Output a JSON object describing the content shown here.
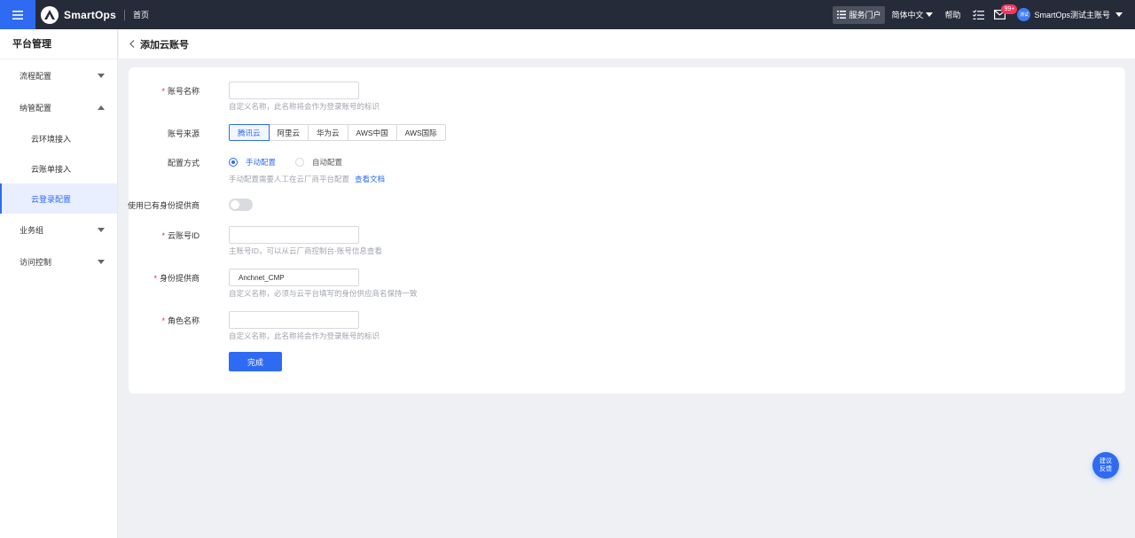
{
  "topbar": {
    "brand": "SmartOps",
    "home_link": "首页",
    "portal_label": "服务门户",
    "language": "简体中文",
    "help": "帮助",
    "mail_badge": "99+",
    "avatar_text": "测试",
    "user_name": "SmartOps测试主账号",
    "colors": {
      "bar": "#262b3a",
      "accent": "#2f6bf2",
      "badge": "#f5365c"
    }
  },
  "sidebar": {
    "title": "平台管理",
    "groups": [
      {
        "label": "流程配置",
        "icon": "chevron-down-icon"
      },
      {
        "label": "纳管配置",
        "icon": "chevron-up-icon",
        "expanded": true,
        "items": [
          {
            "label": "云环境接入"
          },
          {
            "label": "云账单接入"
          },
          {
            "label": "云登录配置",
            "active": true
          }
        ]
      },
      {
        "label": "业务组",
        "icon": "chevron-down-icon"
      },
      {
        "label": "访问控制",
        "icon": "chevron-down-icon"
      }
    ]
  },
  "page": {
    "title": "添加云账号"
  },
  "form": {
    "account_name": {
      "label": "账号名称",
      "required": "*",
      "value": "",
      "hint": "自定义名称，此名称将会作为登录账号的标识"
    },
    "account_source": {
      "label": "账号来源",
      "options": [
        "腾讯云",
        "阿里云",
        "华为云",
        "AWS中国",
        "AWS国际"
      ],
      "selected": "腾讯云"
    },
    "config_method": {
      "label": "配置方式",
      "options": [
        "手动配置",
        "自动配置"
      ],
      "selected": "手动配置",
      "hint": "手动配置需要人工在云厂商平台配置",
      "hint_link": "查看文档"
    },
    "use_existing_idp": {
      "label": "使用已有身份提供商",
      "enabled": false
    },
    "cloud_account_id": {
      "label": "云账号ID",
      "required": "*",
      "value": "",
      "hint": "主账号ID，可以从云厂商控制台-账号信息查看"
    },
    "identity_provider": {
      "label": "身份提供商",
      "required": "*",
      "value": "Anchnet_CMP",
      "hint": "自定义名称，必须与云平台填写的身份供应商名保持一致"
    },
    "role_name": {
      "label": "角色名称",
      "required": "*",
      "value": "",
      "hint": "自定义名称，此名称将会作为登录账号的标识"
    },
    "submit_label": "完成"
  },
  "feedback": {
    "line1": "建议",
    "line2": "反馈"
  }
}
